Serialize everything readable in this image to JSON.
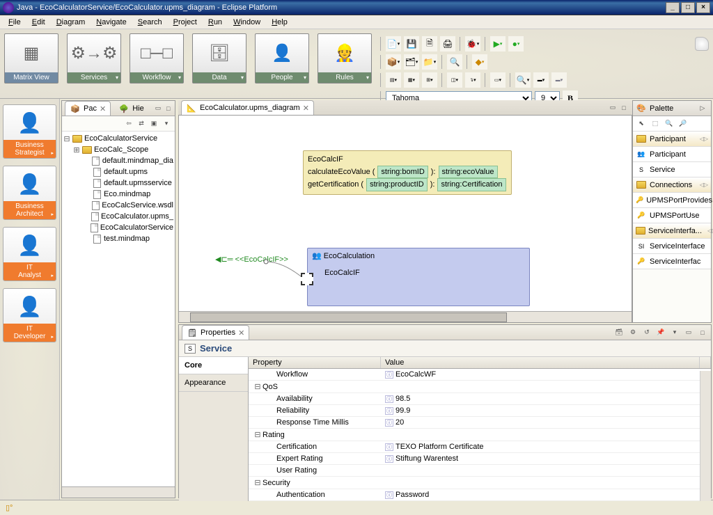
{
  "title": "Java - EcoCalculatorService/EcoCalculator.upms_diagram - Eclipse Platform",
  "menu": [
    "File",
    "Edit",
    "Diagram",
    "Navigate",
    "Search",
    "Project",
    "Run",
    "Window",
    "Help"
  ],
  "bigbuttons": [
    {
      "label": "Matrix View",
      "active": true
    },
    {
      "label": "Services"
    },
    {
      "label": "Workflow"
    },
    {
      "label": "Data"
    },
    {
      "label": "People"
    },
    {
      "label": "Rules"
    }
  ],
  "font": {
    "name": "Tahoma",
    "size": "9"
  },
  "roles": [
    "Business Strategist",
    "Business Architect",
    "IT Analyst",
    "IT Developer"
  ],
  "leftTabs": {
    "primary": "Pac",
    "secondary": "Hie"
  },
  "tree": {
    "root": "EcoCalculatorService",
    "scope": "EcoCalc_Scope",
    "files": [
      "default.mindmap_dia",
      "default.upms",
      "default.upmsservice",
      "Eco.mindmap",
      "EcoCalcService.wsdl",
      "EcoCalculator.upms_",
      "EcoCalculatorService",
      "test.mindmap"
    ]
  },
  "editorTab": "EcoCalculator.upms_diagram",
  "interface": {
    "name": "EcoCalcIF",
    "ops": [
      {
        "name": "calculateEcoValue",
        "param": "string:bomID",
        "ret": "string:ecoValue"
      },
      {
        "name": "getCertification",
        "param": "string:productID",
        "ret": "string:Certification"
      }
    ]
  },
  "edge": "<<EcoCalcIF>>",
  "participant": {
    "name": "EcoCalculation",
    "service": "EcoCalcIF"
  },
  "palette": {
    "title": "Palette",
    "sections": [
      {
        "header": "Participant",
        "items": [
          "Participant",
          "Service"
        ]
      },
      {
        "header": "Connections",
        "items": [
          "UPMSPortProvides",
          "UPMSPortUse"
        ]
      },
      {
        "header": "ServiceInterfa...",
        "items": [
          "ServiceInterface",
          "ServiceInterfac"
        ]
      }
    ]
  },
  "properties": {
    "view": "Properties",
    "subject": "Service",
    "tabs": [
      "Core",
      "Appearance"
    ],
    "cols": [
      "Property",
      "Value"
    ],
    "rows": [
      {
        "indent": 1,
        "name": "Workflow",
        "value": "EcoCalcWF"
      },
      {
        "indent": 0,
        "name": "QoS",
        "value": "",
        "group": true
      },
      {
        "indent": 1,
        "name": "Availability",
        "value": "98.5"
      },
      {
        "indent": 1,
        "name": "Reliability",
        "value": "99.9"
      },
      {
        "indent": 1,
        "name": "Response Time Millis",
        "value": "20"
      },
      {
        "indent": 0,
        "name": "Rating",
        "value": "",
        "group": true
      },
      {
        "indent": 1,
        "name": "Certification",
        "value": "TEXO Platform Certificate"
      },
      {
        "indent": 1,
        "name": "Expert Rating",
        "value": "Stiftung Warentest"
      },
      {
        "indent": 1,
        "name": "User Rating",
        "value": ""
      },
      {
        "indent": 0,
        "name": "Security",
        "value": "",
        "group": true
      },
      {
        "indent": 1,
        "name": "Authentication",
        "value": "Password"
      }
    ]
  }
}
